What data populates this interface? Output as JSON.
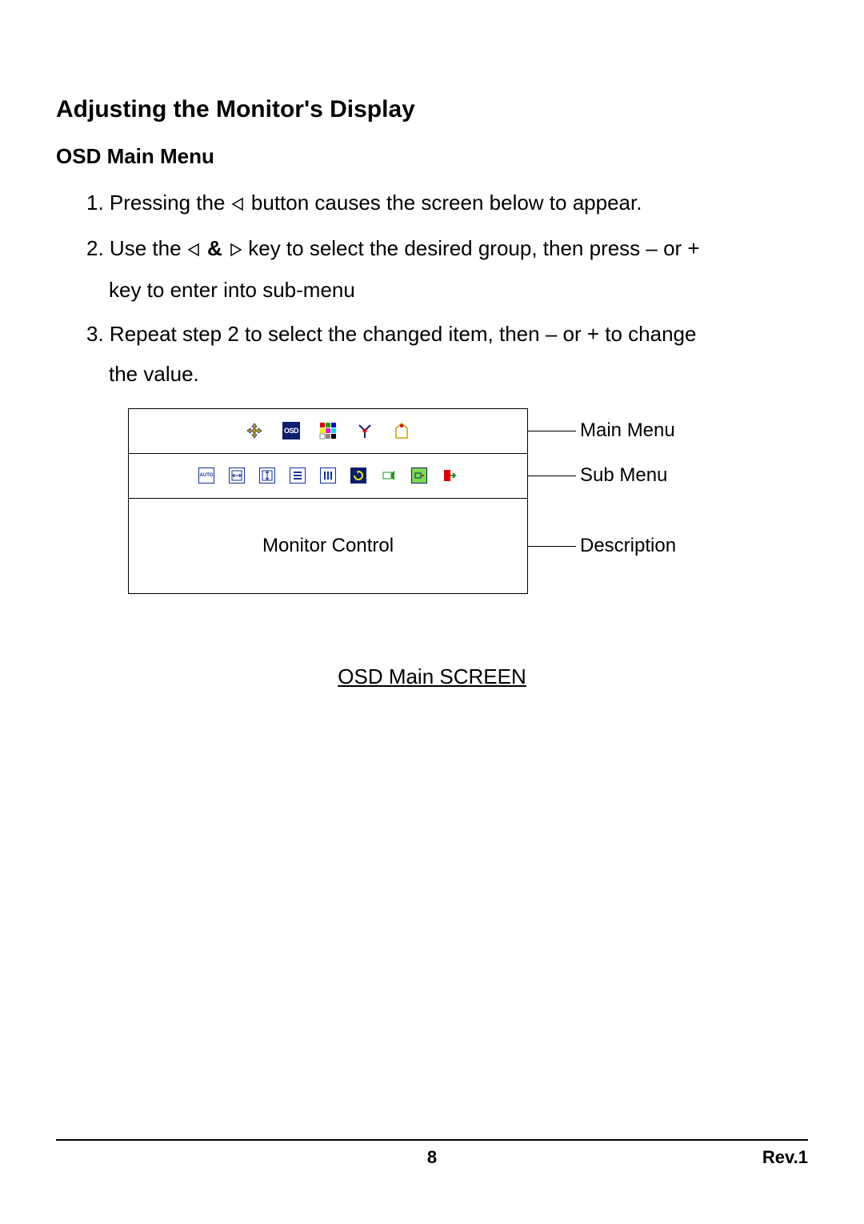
{
  "heading": "Adjusting the Monitor's Display",
  "subheading": "OSD Main Menu",
  "steps": {
    "s1_a": "Pressing the ",
    "s1_b": " button causes the screen below to appear.",
    "s2_a": "Use the ",
    "s2_amp": "&",
    "s2_b": " key to select the desired group, then press – or +",
    "s2_c": "key to enter into sub-menu",
    "s3_a": "Repeat step 2 to select the changed item, then – or + to change",
    "s3_b": "the value."
  },
  "osd": {
    "desc_text": "Monitor Control",
    "label_main": "Main Menu",
    "label_sub": "Sub Menu",
    "label_desc": "Description"
  },
  "caption": "OSD Main SCREEN",
  "footer": {
    "page": "8",
    "rev": "Rev.1"
  },
  "icons": {
    "main": [
      "position",
      "osd",
      "color",
      "tools",
      "misc"
    ],
    "sub": [
      "auto",
      "hpos",
      "vpos",
      "list",
      "width",
      "reset",
      "info1",
      "info2",
      "exit"
    ],
    "osd_text": "OSD",
    "auto_text": "AUTO"
  }
}
